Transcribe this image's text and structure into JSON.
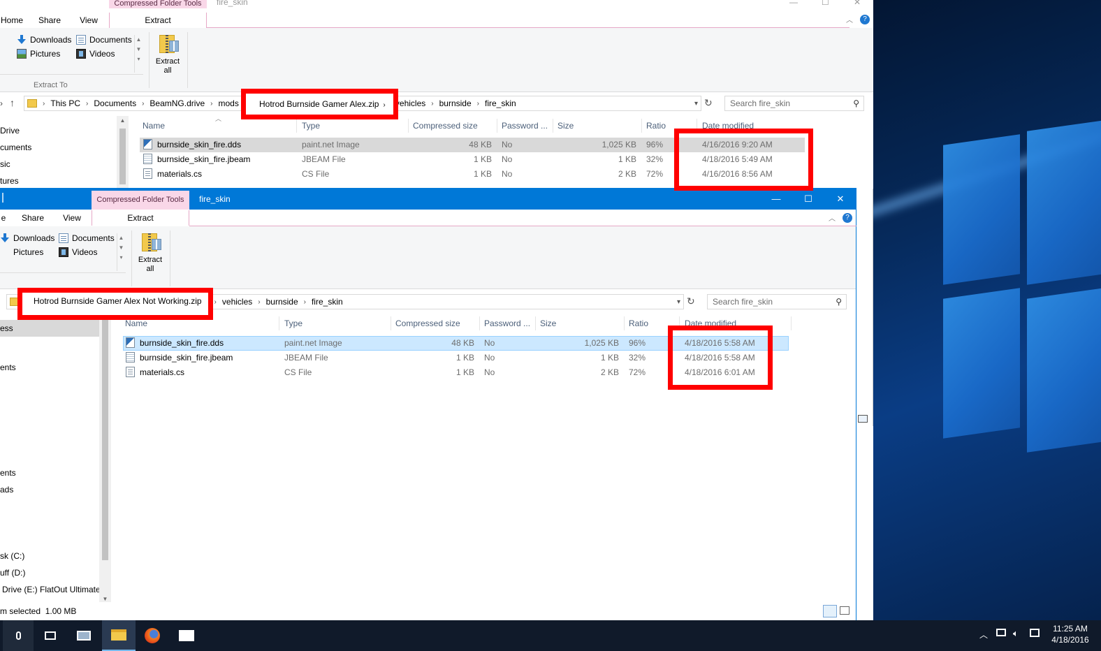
{
  "back_window": {
    "ctx_title": "Compressed Folder Tools",
    "window_title": "fire_skin",
    "tabs": [
      "Home",
      "Share",
      "View",
      "Extract"
    ],
    "quick_links": [
      "Downloads",
      "Documents",
      "Pictures",
      "Videos"
    ],
    "extract_to_label": "Extract To",
    "extract_all_label": "Extract\nall",
    "address": [
      "This PC",
      "Documents",
      "BeamNG.drive",
      "mods",
      "Hotrod Burnside Gamer Alex.zip",
      "vehicles",
      "burnside",
      "fire_skin"
    ],
    "search_placeholder": "Search fire_skin",
    "nav_items": [
      "Drive",
      "cuments",
      "sic",
      "tures"
    ],
    "columns": [
      "Name",
      "Type",
      "Compressed size",
      "Password ...",
      "Size",
      "Ratio",
      "Date modified"
    ],
    "files": [
      {
        "name": "burnside_skin_fire.dds",
        "type": "paint.net Image",
        "compressed": "48 KB",
        "password": "No",
        "size": "1,025 KB",
        "ratio": "96%",
        "date": "4/16/2016 9:20 AM",
        "icon": "dds-file-icon"
      },
      {
        "name": "burnside_skin_fire.jbeam",
        "type": "JBEAM File",
        "compressed": "1 KB",
        "password": "No",
        "size": "1 KB",
        "ratio": "32%",
        "date": "4/18/2016 5:49 AM",
        "icon": "jbeam-file-icon"
      },
      {
        "name": "materials.cs",
        "type": "CS File",
        "compressed": "1 KB",
        "password": "No",
        "size": "2 KB",
        "ratio": "72%",
        "date": "4/16/2016 8:56 AM",
        "icon": "cs-file-icon"
      }
    ]
  },
  "front_window": {
    "ctx_title": "Compressed Folder Tools",
    "window_title": "fire_skin",
    "tabs": [
      "e",
      "Share",
      "View",
      "Extract"
    ],
    "quick_links": [
      "Downloads",
      "Documents",
      "Pictures",
      "Videos"
    ],
    "extract_all_label": "Extract\nall",
    "address": [
      "Hotrod Burnside Gamer Alex Not Working.zip",
      "vehicles",
      "burnside",
      "fire_skin"
    ],
    "search_placeholder": "Search fire_skin",
    "nav_items": [
      "ess",
      "ents",
      "ents",
      "ads",
      "sk (C:)",
      "uff (D:)",
      "Drive (E:) FlatOut Ultimate"
    ],
    "columns": [
      "Name",
      "Type",
      "Compressed size",
      "Password ...",
      "Size",
      "Ratio",
      "Date modified"
    ],
    "files": [
      {
        "name": "burnside_skin_fire.dds",
        "type": "paint.net Image",
        "compressed": "48 KB",
        "password": "No",
        "size": "1,025 KB",
        "ratio": "96%",
        "date": "4/18/2016 5:58 AM",
        "icon": "dds-file-icon"
      },
      {
        "name": "burnside_skin_fire.jbeam",
        "type": "JBEAM File",
        "compressed": "1 KB",
        "password": "No",
        "size": "1 KB",
        "ratio": "32%",
        "date": "4/18/2016 5:58 AM",
        "icon": "jbeam-file-icon"
      },
      {
        "name": "materials.cs",
        "type": "CS File",
        "compressed": "1 KB",
        "password": "No",
        "size": "2 KB",
        "ratio": "72%",
        "date": "4/18/2016 6:01 AM",
        "icon": "cs-file-icon"
      }
    ],
    "status": "m selected  1.00 MB"
  },
  "taskbar": {
    "time": "11:25 AM",
    "date": "4/18/2016",
    "apps": [
      "microphone-icon",
      "task-view-icon",
      "network-app-icon",
      "file-explorer-icon",
      "firefox-icon",
      "mail-icon"
    ]
  },
  "colors": {
    "accent": "#0078d7",
    "highlight_red": "#ff0000",
    "selection": "#cce8ff",
    "ctx_tab": "#f9d7e8"
  }
}
